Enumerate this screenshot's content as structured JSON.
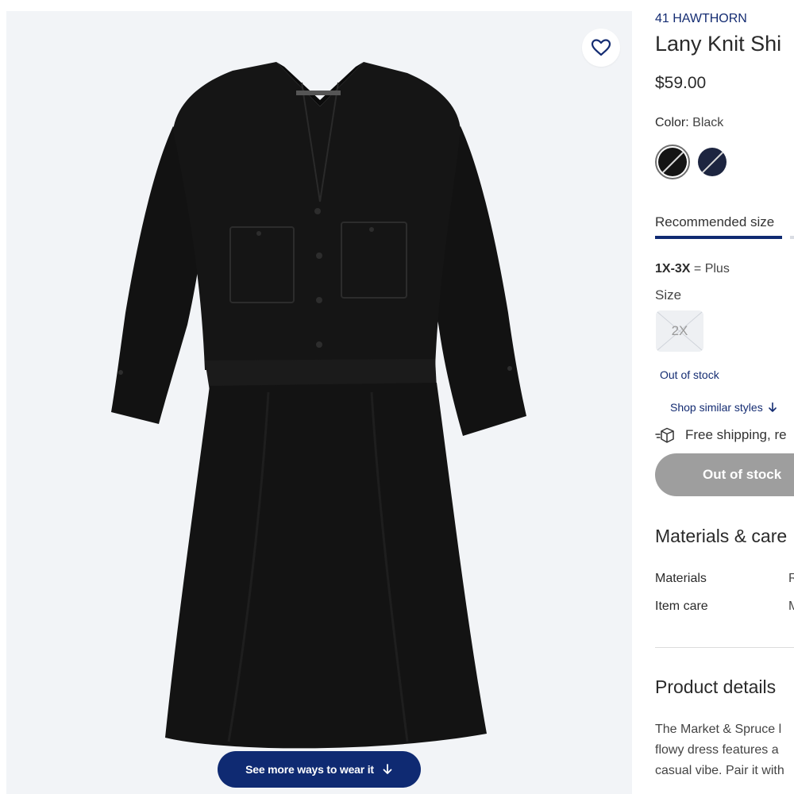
{
  "product": {
    "brand": "41 HAWTHORN",
    "title": "Lany Knit Shi",
    "price": "$59.00"
  },
  "color": {
    "label": "Color:",
    "selected": "Black",
    "swatches": [
      {
        "name": "Black",
        "hex": "#141414",
        "selected": true
      },
      {
        "name": "Navy",
        "hex": "#1d2540",
        "selected": false
      }
    ]
  },
  "size": {
    "tab_label": "Recommended size",
    "range_code": "1X-3X",
    "range_text": " = Plus",
    "label": "Size",
    "options": [
      "2X"
    ],
    "status": "Out of stock",
    "shop_similar": "Shop similar styles"
  },
  "shipping": {
    "text": "Free shipping, re"
  },
  "cta": {
    "label": "Out of stock"
  },
  "gallery": {
    "wear_button": "See more ways to wear it",
    "background": "#f2f4f7"
  },
  "materials": {
    "heading": "Materials & care",
    "rows": [
      {
        "label": "Materials",
        "value": "R"
      },
      {
        "label": "Item care",
        "value": "M"
      }
    ]
  },
  "details": {
    "heading": "Product details",
    "lines": [
      "The Market & Spruce l",
      "flowy dress features a",
      "casual vibe. Pair it with"
    ]
  },
  "colors": {
    "brand_navy": "#0f2a72",
    "link_navy": "#142c72",
    "disabled_gray": "#9e9e9e"
  }
}
